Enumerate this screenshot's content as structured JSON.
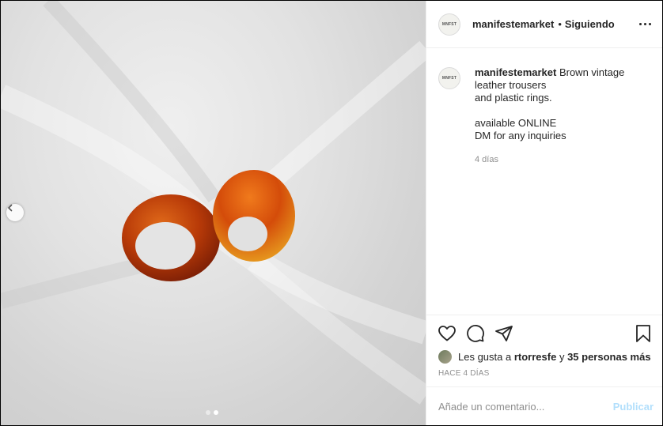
{
  "media": {
    "dots": [
      false,
      true
    ],
    "prev_icon": "chevron-left-icon"
  },
  "header": {
    "avatar_text": "MNFST",
    "username": "manifestemarket",
    "separator": "•",
    "following": "Siguiendo",
    "more_icon": "more-horizontal-icon"
  },
  "caption": {
    "avatar_text": "MNFST",
    "username": "manifestemarket",
    "lines": [
      "Brown vintage",
      "leather trousers",
      "and plastic rings.",
      "",
      "available ONLINE",
      "DM for any inquiries"
    ],
    "time": "4 días"
  },
  "actions": {
    "icons": [
      "heart-icon",
      "comment-icon",
      "share-icon",
      "bookmark-icon"
    ],
    "likes_prefix": "Les gusta a",
    "likes_user": "rtorresfe",
    "likes_and": "y",
    "likes_others": "35 personas más",
    "ago": "HACE 4 DÍAS"
  },
  "comment": {
    "placeholder": "Añade un comentario...",
    "post": "Publicar"
  },
  "colors": {
    "text": "#262626",
    "muted": "#8e8e8e",
    "post_disabled": "#b2dffc",
    "border": "#efefef"
  }
}
